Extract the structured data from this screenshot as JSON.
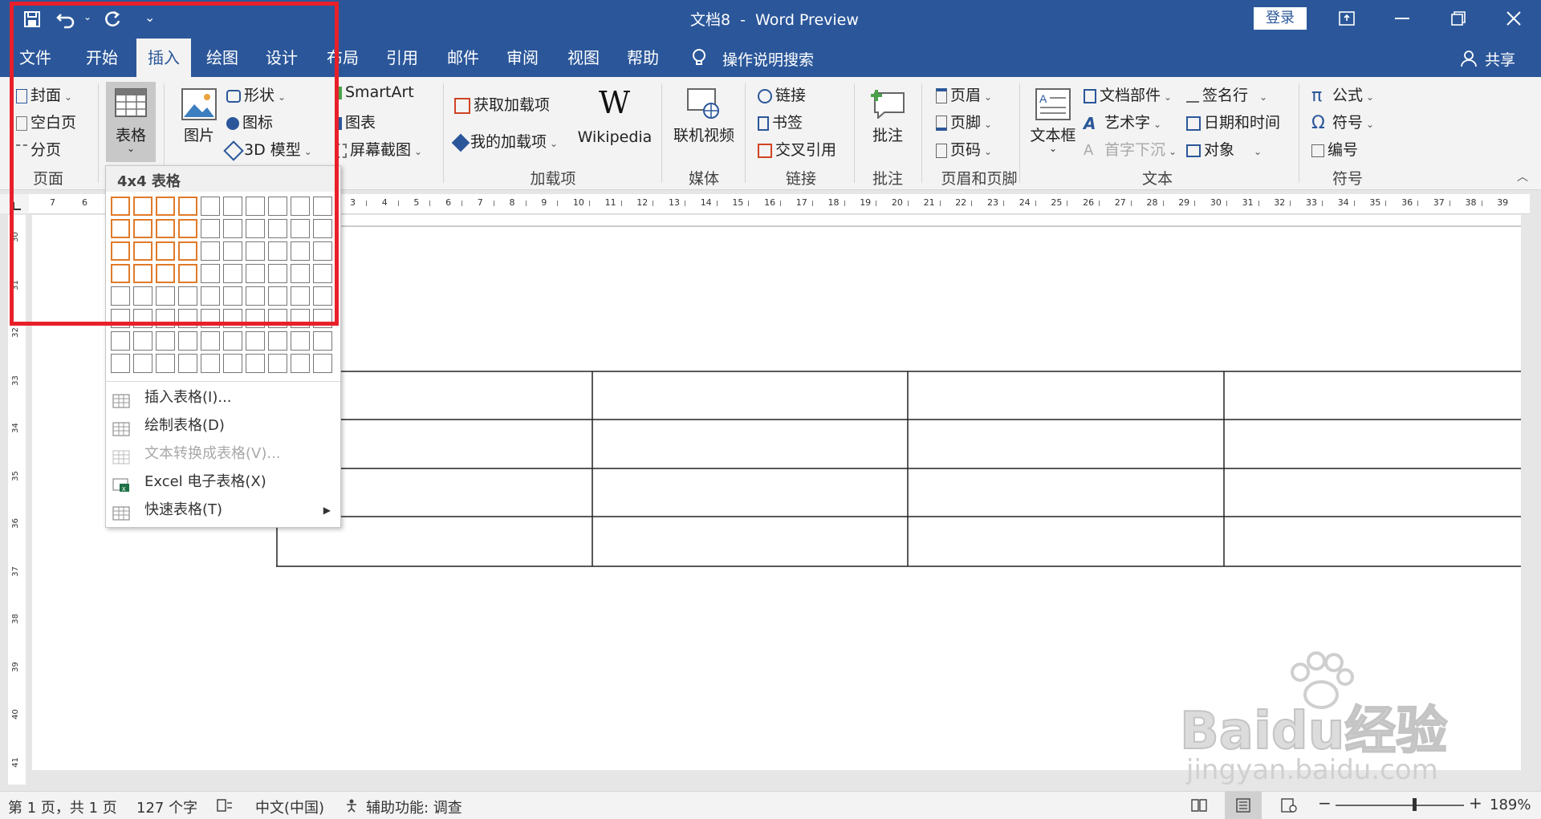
{
  "title_bar": {
    "doc_title": "文档8",
    "separator": "-",
    "app_name": "Word Preview",
    "login_label": "登录"
  },
  "tabs": [
    "文件",
    "开始",
    "插入",
    "绘图",
    "设计",
    "布局",
    "引用",
    "邮件",
    "审阅",
    "视图",
    "帮助"
  ],
  "active_tab": "插入",
  "tell_me": "操作说明搜索",
  "share_label": "共享",
  "ribbon": {
    "pages": {
      "items": [
        "封面",
        "空白页",
        "分页"
      ],
      "group": "页面"
    },
    "table": {
      "label": "表格"
    },
    "illustrations": {
      "picture": "图片",
      "shapes": "形状",
      "icons": "图标",
      "model3d": "3D 模型",
      "smartart": "SmartArt",
      "chart": "图表",
      "screenshot": "屏幕截图"
    },
    "addins": {
      "get": "获取加载项",
      "mine": "我的加载项",
      "wikipedia": "Wikipedia",
      "group": "加载项"
    },
    "media": {
      "online_video": "联机视频",
      "group": "媒体"
    },
    "links": {
      "link": "链接",
      "bookmark": "书签",
      "crossref": "交叉引用",
      "group": "链接"
    },
    "comments": {
      "comment": "批注",
      "group": "批注"
    },
    "header_footer": {
      "header": "页眉",
      "footer": "页脚",
      "page_number": "页码",
      "group": "页眉和页脚"
    },
    "text": {
      "textbox": "文本框",
      "quickparts": "文档部件",
      "wordart": "艺术字",
      "dropcap": "首字下沉",
      "signature": "签名行",
      "datetime": "日期和时间",
      "object": "对象",
      "group": "文本"
    },
    "symbols": {
      "equation": "公式",
      "symbol": "符号",
      "number": "编号",
      "group": "符号"
    }
  },
  "table_dropdown": {
    "header": "4x4 表格",
    "grid_cols": 10,
    "grid_rows": 8,
    "selected_cols": 4,
    "selected_rows": 4,
    "menu": [
      {
        "label": "插入表格(I)...",
        "disabled": false,
        "submenu": false
      },
      {
        "label": "绘制表格(D)",
        "disabled": false,
        "submenu": false
      },
      {
        "label": "文本转换成表格(V)...",
        "disabled": true,
        "submenu": false
      },
      {
        "label": "Excel 电子表格(X)",
        "disabled": false,
        "submenu": false
      },
      {
        "label": "快速表格(T)",
        "disabled": false,
        "submenu": true
      }
    ]
  },
  "ruler": {
    "left_numbers": [
      "7",
      "6"
    ],
    "numbers": [
      "3",
      "4",
      "5",
      "6",
      "7",
      "8",
      "9",
      "10",
      "11",
      "12",
      "13",
      "14",
      "15",
      "16",
      "17",
      "18",
      "19",
      "20",
      "21",
      "22",
      "23",
      "24",
      "25",
      "26",
      "27",
      "28",
      "29",
      "30",
      "31",
      "32",
      "33",
      "34",
      "35",
      "36",
      "37",
      "38",
      "39"
    ],
    "vertical": [
      "30",
      "31",
      "32",
      "33",
      "34",
      "35",
      "36",
      "37",
      "38",
      "39",
      "40",
      "41"
    ]
  },
  "status": {
    "page": "第 1 页，共 1 页",
    "words": "127 个字",
    "language": "中文(中国)",
    "accessibility": "辅助功能: 调查",
    "zoom": "189%"
  },
  "watermark": {
    "text1": "Baidu经验",
    "text2": "jingyan.baidu.com"
  },
  "colors": {
    "accent": "#2b579a",
    "selection": "#e07b2a",
    "highlight_box": "#e8202a"
  }
}
